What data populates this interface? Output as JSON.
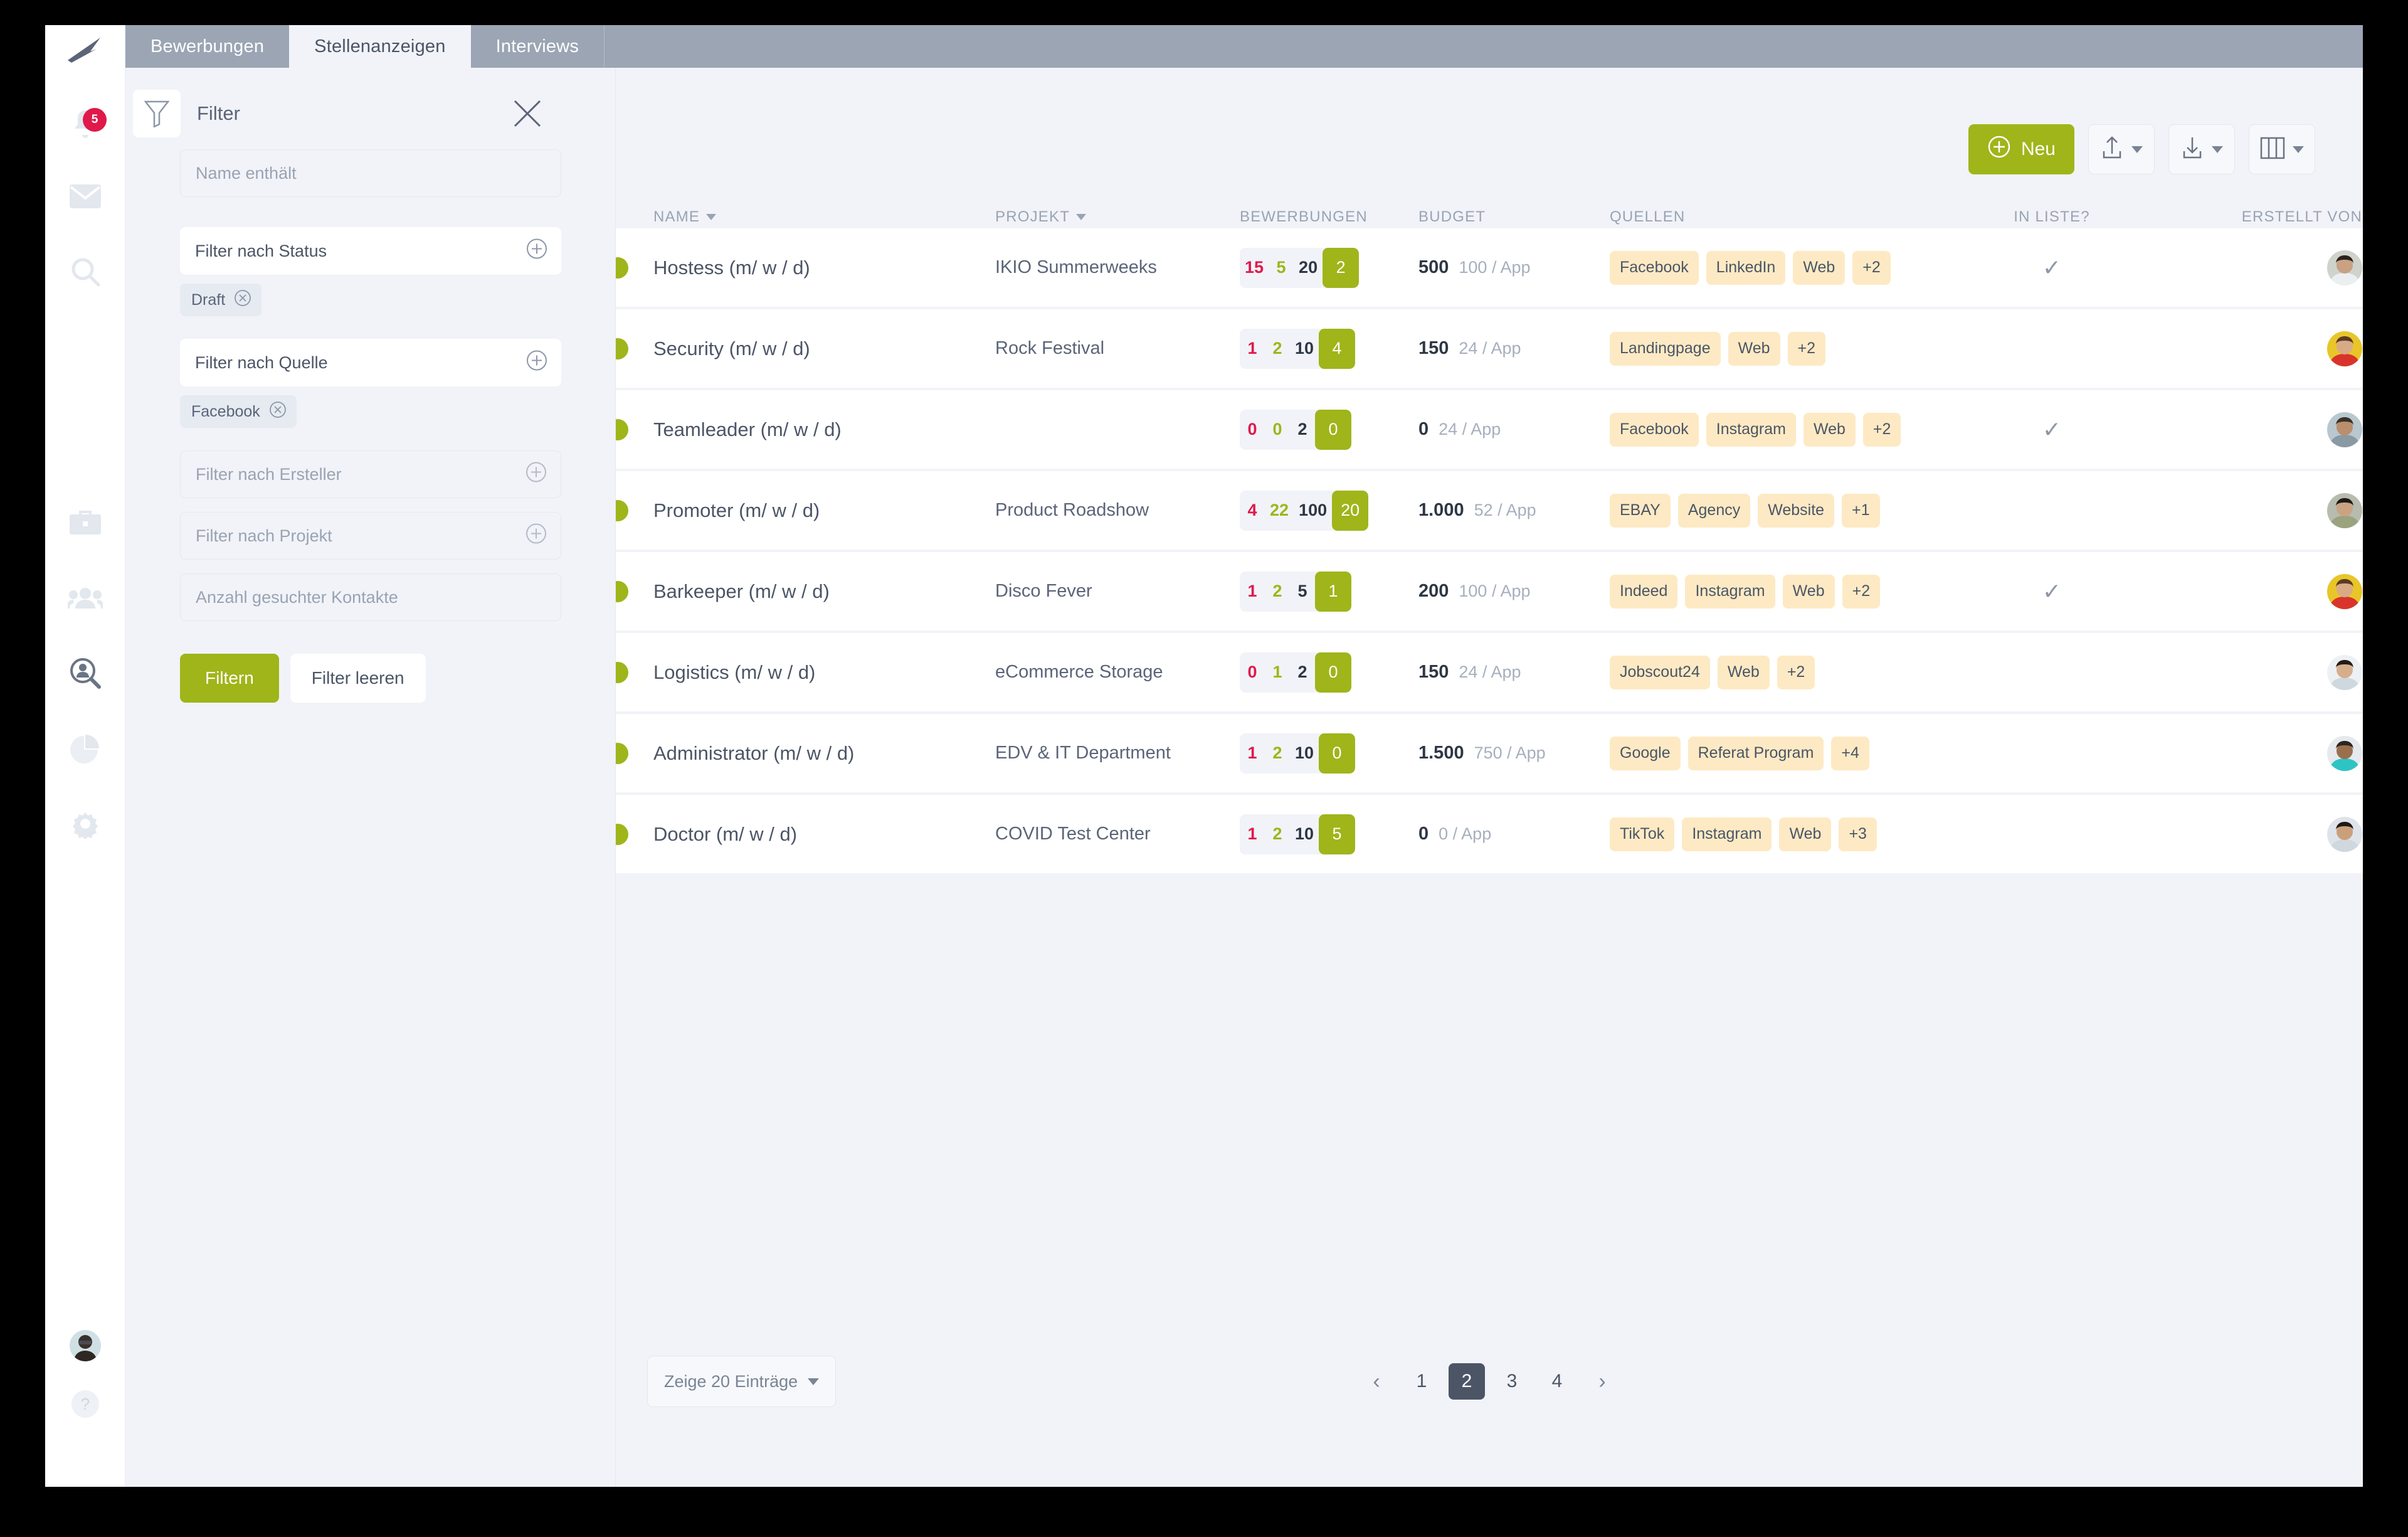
{
  "app": {
    "accent_green": "#9fb51a",
    "accent_red": "#e0194b",
    "tabbar_bg": "#9ba5b4",
    "page_bg": "#f1f3f8",
    "tag_bg": "#fdeac4"
  },
  "rail": {
    "items": [
      {
        "name": "notifications",
        "icon": "bell-icon",
        "badge": "5"
      },
      {
        "name": "messages",
        "icon": "envelope-icon",
        "badge": ""
      },
      {
        "name": "search",
        "icon": "magnifier-icon",
        "badge": ""
      },
      {
        "name": "jobs",
        "icon": "briefcase-icon",
        "badge": ""
      },
      {
        "name": "contacts",
        "icon": "people-icon",
        "badge": ""
      },
      {
        "name": "recruiting",
        "icon": "person-search-icon",
        "badge": ""
      },
      {
        "name": "reports",
        "icon": "pie-chart-icon",
        "badge": ""
      },
      {
        "name": "settings",
        "icon": "gear-icon",
        "badge": ""
      }
    ],
    "help_label": "?"
  },
  "tabs": [
    {
      "label": "Bewerbungen",
      "active": false
    },
    {
      "label": "Stellenanzeigen",
      "active": true
    },
    {
      "label": "Interviews",
      "active": false
    }
  ],
  "filter": {
    "title": "Filter",
    "icon": "funnel-icon",
    "close_icon": "close-icon",
    "name_placeholder": "Name enthält",
    "name_value": "",
    "status_label": "Filter nach Status",
    "status_chips": [
      "Draft"
    ],
    "quelle_label": "Filter nach Quelle",
    "quelle_chips": [
      "Facebook"
    ],
    "ersteller_placeholder": "Filter nach Ersteller",
    "projekt_placeholder": "Filter nach Projekt",
    "kontakte_placeholder": "Anzahl gesuchter Kontakte",
    "apply_label": "Filtern",
    "clear_label": "Filter leeren"
  },
  "toolbar": {
    "new_label": "Neu",
    "new_icon": "plus-circle-icon",
    "upload_icon": "upload-icon",
    "download_icon": "download-icon",
    "columns_icon": "columns-icon"
  },
  "table": {
    "columns": [
      {
        "key": "name",
        "label": "NAME",
        "sortable": true
      },
      {
        "key": "proj",
        "label": "PROJEKT",
        "sortable": true
      },
      {
        "key": "bew",
        "label": "BEWERBUNGEN",
        "sortable": false
      },
      {
        "key": "budget",
        "label": "BUDGET",
        "sortable": false
      },
      {
        "key": "quell",
        "label": "QUELLEN",
        "sortable": false
      },
      {
        "key": "liste",
        "label": "IN LISTE?",
        "sortable": false
      },
      {
        "key": "erst",
        "label": "ERSTELLT VON",
        "sortable": false
      }
    ],
    "rows": [
      {
        "status": "green",
        "name": "Hostess (m/ w / d)",
        "projekt": "IKIO Summerweeks",
        "bewerbungen": {
          "red": "15",
          "green": "5",
          "dark": "20",
          "highlight": "2"
        },
        "budget": "500",
        "budget_per": "100 / App",
        "quellen": [
          "Facebook",
          "LinkedIn",
          "Web"
        ],
        "quellen_more": "+2",
        "in_liste": true
      },
      {
        "status": "green",
        "name": "Security (m/ w / d)",
        "projekt": "Rock Festival",
        "bewerbungen": {
          "red": "1",
          "green": "2",
          "dark": "10",
          "highlight": "4"
        },
        "budget": "150",
        "budget_per": "24 / App",
        "quellen": [
          "Landingpage",
          "Web"
        ],
        "quellen_more": "+2",
        "in_liste": false
      },
      {
        "status": "green",
        "name": "Teamleader (m/ w / d)",
        "projekt": "",
        "bewerbungen": {
          "red": "0",
          "green": "0",
          "dark": "2",
          "highlight": "0"
        },
        "budget": "0",
        "budget_per": "24 / App",
        "quellen": [
          "Facebook",
          "Instagram",
          "Web"
        ],
        "quellen_more": "+2",
        "in_liste": true
      },
      {
        "status": "green",
        "name": "Promoter (m/ w / d)",
        "projekt": "Product Roadshow",
        "bewerbungen": {
          "red": "4",
          "green": "22",
          "dark": "100",
          "highlight": "20"
        },
        "budget": "1.000",
        "budget_per": "52 / App",
        "quellen": [
          "EBAY",
          "Agency",
          "Website"
        ],
        "quellen_more": "+1",
        "in_liste": false
      },
      {
        "status": "green",
        "name": "Barkeeper (m/ w / d)",
        "projekt": "Disco Fever",
        "bewerbungen": {
          "red": "1",
          "green": "2",
          "dark": "5",
          "highlight": "1"
        },
        "budget": "200",
        "budget_per": "100 / App",
        "quellen": [
          "Indeed",
          "Instagram",
          "Web"
        ],
        "quellen_more": "+2",
        "in_liste": true
      },
      {
        "status": "green",
        "name": "Logistics (m/ w / d)",
        "projekt": "eCommerce Storage",
        "bewerbungen": {
          "red": "0",
          "green": "1",
          "dark": "2",
          "highlight": "0"
        },
        "budget": "150",
        "budget_per": "24 / App",
        "quellen": [
          "Jobscout24",
          "Web"
        ],
        "quellen_more": "+2",
        "in_liste": false
      },
      {
        "status": "green",
        "name": "Administrator (m/ w / d)",
        "projekt": "EDV & IT Department",
        "bewerbungen": {
          "red": "1",
          "green": "2",
          "dark": "10",
          "highlight": "0"
        },
        "budget": "1.500",
        "budget_per": "750 / App",
        "quellen": [
          "Google",
          "Referat Program"
        ],
        "quellen_more": "+4",
        "in_liste": false
      },
      {
        "status": "green",
        "name": "Doctor (m/ w / d)",
        "projekt": "COVID Test Center",
        "bewerbungen": {
          "red": "1",
          "green": "2",
          "dark": "10",
          "highlight": "5"
        },
        "budget": "0",
        "budget_per": "0 / App",
        "quellen": [
          "TikTok",
          "Instagram",
          "Web"
        ],
        "quellen_more": "+3",
        "in_liste": false
      }
    ]
  },
  "footer": {
    "entries_label": "Zeige 20 Einträge",
    "pages": [
      "1",
      "2",
      "3",
      "4"
    ],
    "active_page": "2",
    "prev_icon": "chevron-left-icon",
    "next_icon": "chevron-right-icon"
  }
}
